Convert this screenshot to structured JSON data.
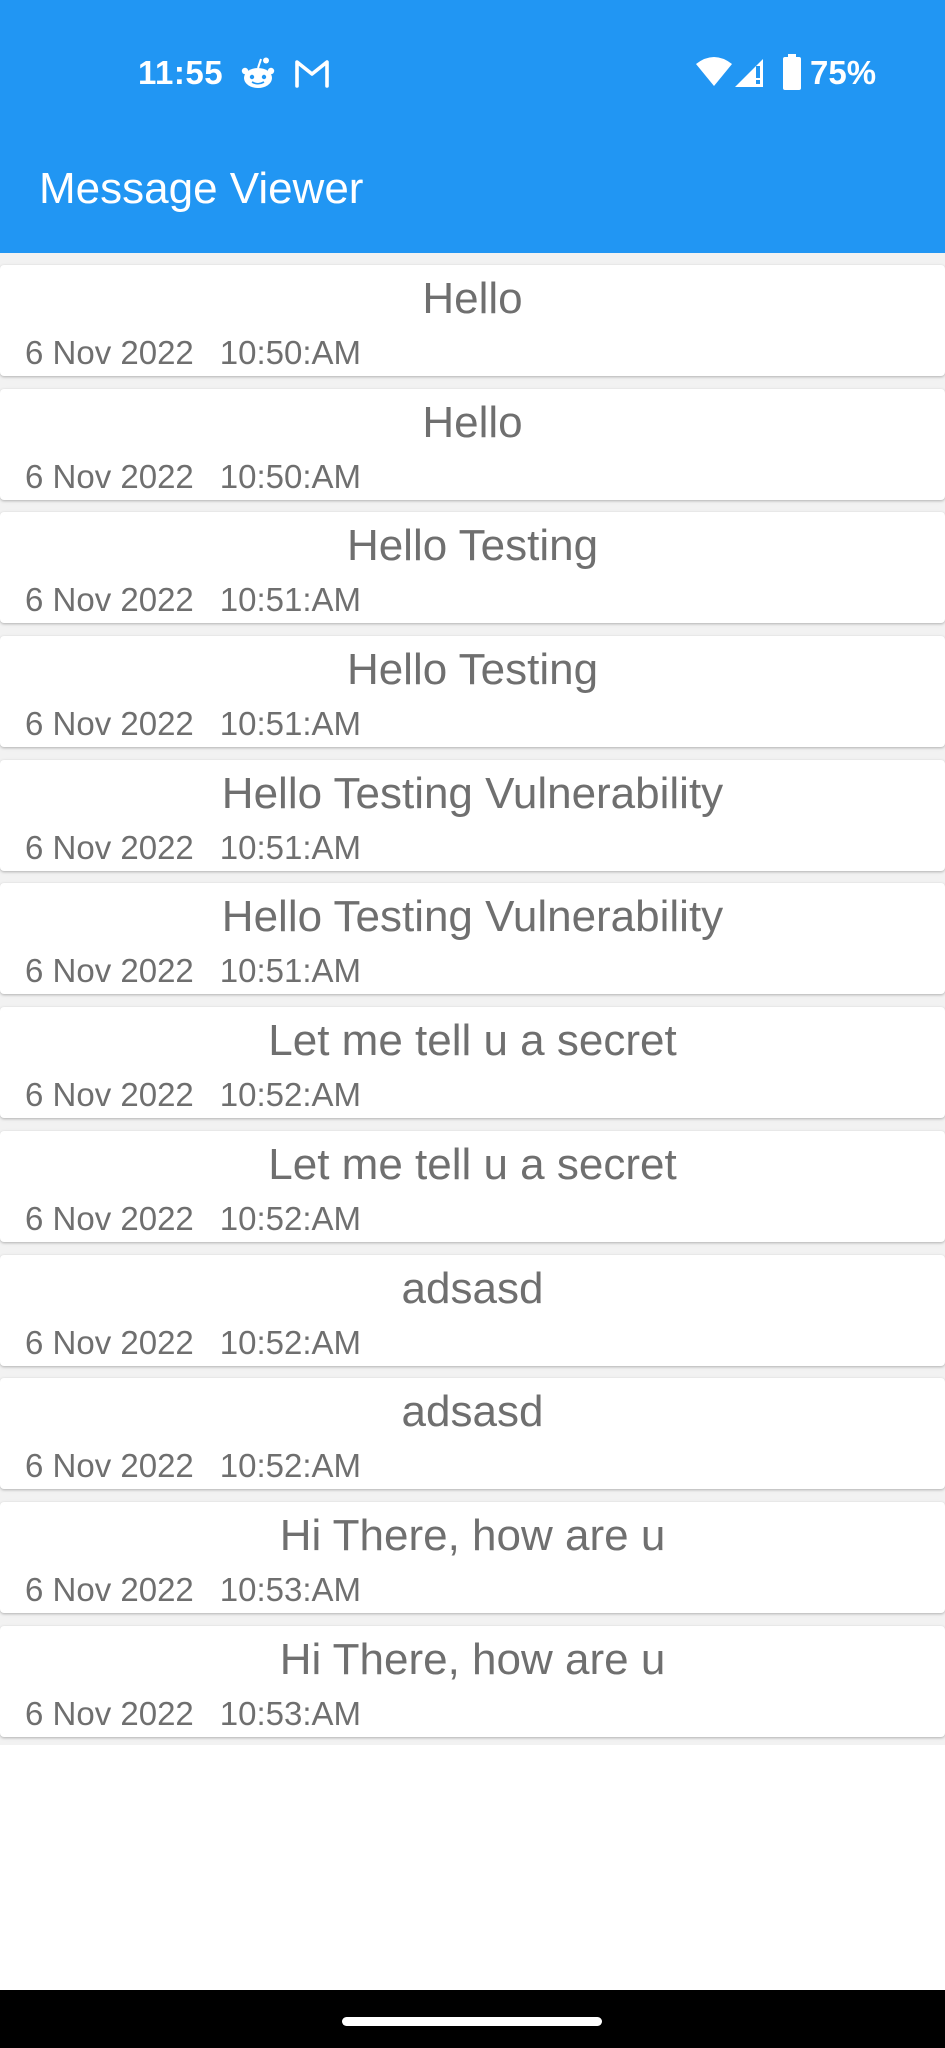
{
  "status_bar": {
    "time": "11:55",
    "notification_icons": [
      "reddit-icon",
      "gmail-icon"
    ],
    "system_icons": [
      "wifi-icon",
      "cell-signal-icon",
      "battery-icon"
    ],
    "battery_percent": "75%"
  },
  "app_bar": {
    "title": "Message Viewer",
    "color": "#2196F3"
  },
  "messages": [
    {
      "text": "Hello",
      "date": "6 Nov 2022",
      "time": "10:50:AM"
    },
    {
      "text": "Hello",
      "date": "6 Nov 2022",
      "time": "10:50:AM"
    },
    {
      "text": "Hello Testing",
      "date": "6 Nov 2022",
      "time": "10:51:AM"
    },
    {
      "text": "Hello Testing",
      "date": "6 Nov 2022",
      "time": "10:51:AM"
    },
    {
      "text": "Hello Testing Vulnerability",
      "date": "6 Nov 2022",
      "time": "10:51:AM"
    },
    {
      "text": "Hello Testing Vulnerability",
      "date": "6 Nov 2022",
      "time": "10:51:AM"
    },
    {
      "text": "Let me tell u a secret",
      "date": "6 Nov 2022",
      "time": "10:52:AM"
    },
    {
      "text": "Let me tell u a secret",
      "date": "6 Nov 2022",
      "time": "10:52:AM"
    },
    {
      "text": "adsasd",
      "date": "6 Nov 2022",
      "time": "10:52:AM"
    },
    {
      "text": "adsasd",
      "date": "6 Nov 2022",
      "time": "10:52:AM"
    },
    {
      "text": "Hi There, how are u",
      "date": "6 Nov 2022",
      "time": "10:53:AM"
    },
    {
      "text": "Hi There, how are u",
      "date": "6 Nov 2022",
      "time": "10:53:AM"
    }
  ]
}
